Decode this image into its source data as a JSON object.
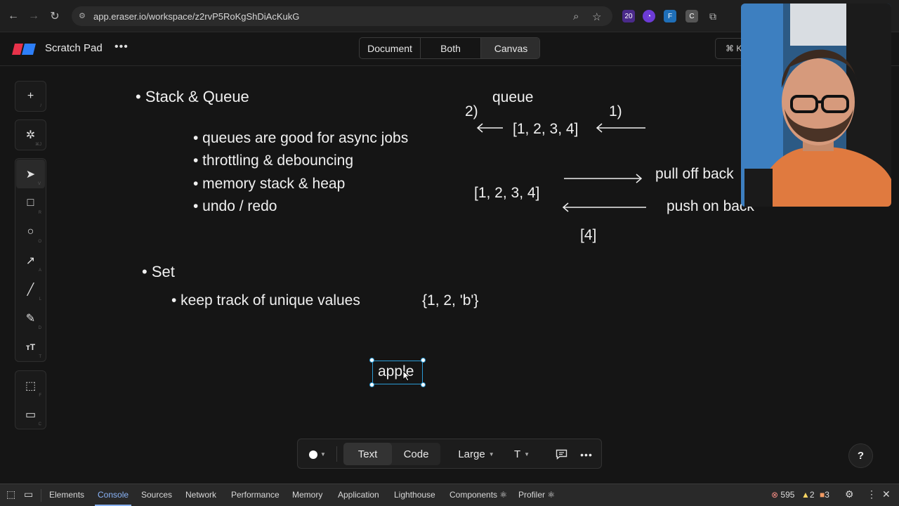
{
  "browser": {
    "url": "app.eraser.io/workspace/z2rvP5RoKgShDiAcKukG",
    "extension_badge": "20",
    "icons": [
      "back-icon",
      "forward-icon",
      "reload-icon",
      "site-info-icon",
      "zoom-icon",
      "star-icon",
      "extensions-icon"
    ]
  },
  "app": {
    "title": "Scratch Pad",
    "view_modes": [
      "Document",
      "Both",
      "Canvas"
    ],
    "active_view": "Canvas",
    "shortcut_hint": "⌘ K"
  },
  "toolbar": {
    "tools": [
      {
        "name": "add",
        "glyph": "+",
        "key": "/"
      },
      {
        "name": "ai-magic",
        "glyph": "✲",
        "key": "⌘J"
      },
      {
        "name": "select",
        "glyph": "➤",
        "key": "V"
      },
      {
        "name": "rectangle",
        "glyph": "□",
        "key": "R"
      },
      {
        "name": "ellipse",
        "glyph": "○",
        "key": "O"
      },
      {
        "name": "arrow",
        "glyph": "↗",
        "key": "A"
      },
      {
        "name": "line",
        "glyph": "╱",
        "key": "L"
      },
      {
        "name": "pencil",
        "glyph": "✎",
        "key": "D"
      },
      {
        "name": "text",
        "glyph": "ᴛT",
        "key": "T"
      },
      {
        "name": "frame",
        "glyph": "⬚",
        "key": "F"
      },
      {
        "name": "comment",
        "glyph": "▭",
        "key": "C"
      }
    ]
  },
  "canvas": {
    "notes": {
      "stack_queue": "• Stack & Queue",
      "bullets": [
        "• queues are good for async jobs",
        "• throttling & debouncing",
        "• memory stack & heap",
        "• undo / redo"
      ],
      "set": "• Set",
      "set_bullet": "• keep track of unique values",
      "set_example": "{1, 2, 'b'}"
    },
    "queue_diagram": {
      "label": "queue",
      "step2": "2)",
      "step1": "1)",
      "array": "[1, 2, 3, 4]"
    },
    "stack_diagram": {
      "array": "[1, 2, 3, 4]",
      "pull": "pull off back",
      "push": "push on back",
      "result": "[4]"
    },
    "selected_text": "apple"
  },
  "format_bar": {
    "color": "#ffffff",
    "mode_text": "Text",
    "mode_code": "Code",
    "size": "Large",
    "font_glyph": "T"
  },
  "help": "?",
  "devtools": {
    "tabs": [
      "Elements",
      "Console",
      "Sources",
      "Network",
      "Performance",
      "Memory",
      "Application",
      "Lighthouse",
      "Components ⚛",
      "Profiler ⚛"
    ],
    "active_tab": "Console",
    "errors": "595",
    "warnings": "2",
    "issues": "3"
  }
}
